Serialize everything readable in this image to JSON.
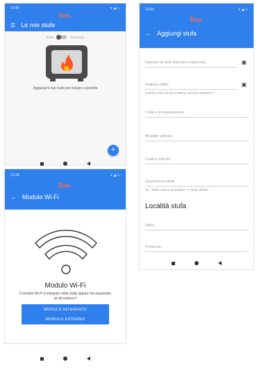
{
  "colors": {
    "primary": "#2f80ed",
    "logo": "#ff6a3d",
    "fire": "#ff5722"
  },
  "screen1": {
    "status_time": "13:44",
    "logo_text": "Bon.",
    "title": "Le mie stufe",
    "toggle_left": "Stufe",
    "toggle_right": "Termostati",
    "empty_text": "Aggiungi le tue stufe per iniziare a gestirle",
    "fab_icon": "plus-icon"
  },
  "screen2": {
    "status_time": "13:44",
    "logo_text": "Bon.",
    "title": "Aggiungi stufa",
    "fields": {
      "serial": "Numero di serie (Numero matricola)",
      "mac": "Indirizzo MAC",
      "mac_hint": "Inserisci solo numeri e lettere, senza il carattere \":\"",
      "reg_code": "Codice di registrazione",
      "model": "Modello articolo",
      "article_code": "Codice articolo",
      "description": "Descrizione stufa",
      "description_hint": "Es. \"Stufa casa in montagna\" o \"Stufa salotto\""
    },
    "section_title": "Località stufa",
    "location_fields": {
      "state": "Stato",
      "province": "Provincia"
    }
  },
  "screen3": {
    "status_time": "13:44",
    "logo_text": "Bon.",
    "title": "Modulo Wi-Fi",
    "heading": "Modulo Wi-Fi",
    "description": "Il modulo Wi-Fi è integrato nella stufa oppure hai acquistato un kit esterno?",
    "btn_integrated": "MODULO INTEGRATO",
    "btn_external": "MODULO ESTERNO"
  }
}
